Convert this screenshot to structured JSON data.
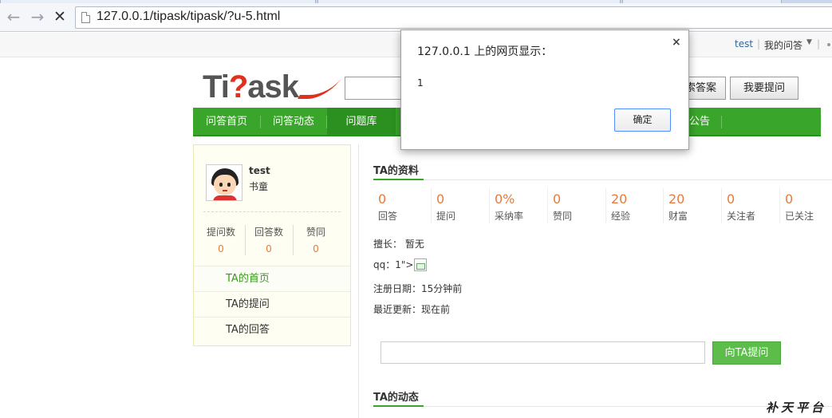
{
  "browser": {
    "url": "127.0.0.1/tipask/tipask/?u-5.html"
  },
  "topbar": {
    "username": "test",
    "sep": "|",
    "my_questions": "我的问答",
    "caret": "▼"
  },
  "logo": {
    "part1": "Ti",
    "part2": "?",
    "part3": "ask"
  },
  "search": {
    "search_answers_label": "索答案",
    "ask_label": "我要提问"
  },
  "nav": {
    "items": [
      "问答首页",
      "问答动态",
      "问题库",
      "公告"
    ]
  },
  "sidebar": {
    "name": "test",
    "rank": "书童",
    "stats": [
      {
        "label": "提问数",
        "value": "0"
      },
      {
        "label": "回答数",
        "value": "0"
      },
      {
        "label": "赞同",
        "value": "0"
      }
    ],
    "links": [
      "TA的首页",
      "TA的提问",
      "TA的回答"
    ]
  },
  "profile": {
    "title": "TA的资料",
    "stats": [
      {
        "value": "0",
        "label": "回答"
      },
      {
        "value": "0",
        "label": "提问"
      },
      {
        "value": "0%",
        "label": "采纳率"
      },
      {
        "value": "0",
        "label": "赞同"
      },
      {
        "value": "20",
        "label": "经验"
      },
      {
        "value": "20",
        "label": "财富"
      },
      {
        "value": "0",
        "label": "关注者"
      },
      {
        "value": "0",
        "label": "已关注"
      }
    ],
    "expertise": "擅长： 暂无",
    "qq": "qq：1\">",
    "registered": "注册日期：15分钟前",
    "last_update": "最近更新：现在前"
  },
  "ask": {
    "button_label": "向TA提问"
  },
  "activity": {
    "title": "TA的动态"
  },
  "watermark": "补天平台",
  "dialog": {
    "title": "127.0.0.1 上的网页显示：",
    "close": "×",
    "message": "1",
    "ok_label": "确定"
  }
}
